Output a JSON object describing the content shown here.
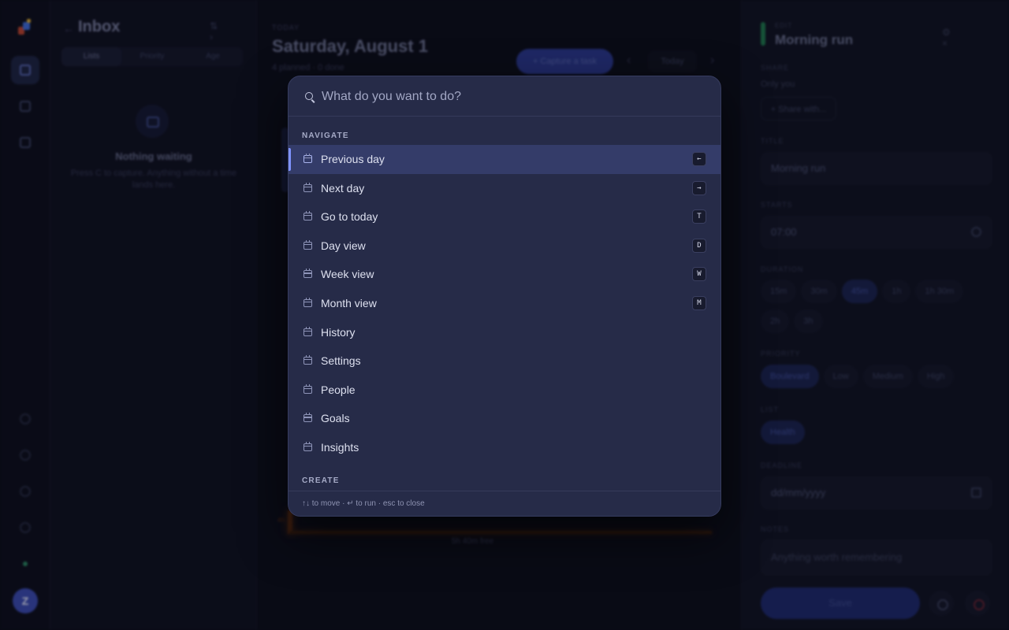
{
  "rail": {
    "avatar_initial": "Z",
    "colors": {
      "accent": "#3c4db5",
      "status_dot": "#2c8a63"
    }
  },
  "inbox": {
    "back_icon": "←",
    "title": "Inbox",
    "actions": "⇅ ›",
    "tabs": [
      {
        "label": "Lists"
      },
      {
        "label": "Priority"
      },
      {
        "label": "Age"
      }
    ],
    "empty_title": "Nothing waiting",
    "empty_subtitle": "Press C to capture. Anything without a time lands here."
  },
  "main": {
    "eyebrow": "TODAY",
    "title": "Saturday, August 1",
    "meta": "4 planned · 0 done",
    "capture_button": "+  Capture a task",
    "prev_icon": "‹",
    "today_button": "Today",
    "next_icon": "›",
    "orange_label": "4h",
    "free_label": "5h 40m free"
  },
  "details": {
    "eyebrow": "EDIT",
    "title": "Morning run",
    "header_icons": "⚙ ×",
    "share_label": "SHARE",
    "share_text": "Only you",
    "share_button": "+  Share with...",
    "title_label": "TITLE",
    "title_value": "Morning run",
    "starts_label": "STARTS",
    "starts_value": "07:00",
    "duration_label": "DURATION",
    "durations": [
      "15m",
      "30m",
      "45m",
      "1h",
      "1h 30m",
      "2h",
      "3h"
    ],
    "priority_label": "PRIORITY",
    "priorities": [
      "Boulevard",
      "Low",
      "Medium",
      "High"
    ],
    "list_label": "LIST",
    "list_value": "Health",
    "deadline_label": "DEADLINE",
    "deadline_placeholder": "dd/mm/yyyy",
    "notes_label": "NOTES",
    "notes_placeholder": "Anything worth remembering",
    "save_button": "Save"
  },
  "palette": {
    "search_placeholder": "What do you want to do?",
    "groups": [
      {
        "label": "NAVIGATE",
        "items": [
          {
            "label": "Previous day",
            "shortcut": "←",
            "icon": "calendar-icon",
            "active": true
          },
          {
            "label": "Next day",
            "shortcut": "→",
            "icon": "calendar-icon"
          },
          {
            "label": "Go to today",
            "shortcut": "T",
            "icon": "calendar-icon"
          },
          {
            "label": "Day view",
            "shortcut": "D",
            "icon": "calendar-icon"
          },
          {
            "label": "Week view",
            "shortcut": "W",
            "icon": "calendar-icon"
          },
          {
            "label": "Month view",
            "shortcut": "M",
            "icon": "calendar-icon"
          },
          {
            "label": "History",
            "shortcut": "",
            "icon": "calendar-icon"
          },
          {
            "label": "Settings",
            "shortcut": "",
            "icon": "calendar-icon"
          },
          {
            "label": "People",
            "shortcut": "",
            "icon": "calendar-icon"
          },
          {
            "label": "Goals",
            "shortcut": "",
            "icon": "calendar-icon"
          },
          {
            "label": "Insights",
            "shortcut": "",
            "icon": "calendar-icon"
          }
        ]
      },
      {
        "label": "CREATE",
        "items": []
      }
    ],
    "footer": "↑↓ to move · ↵ to run · esc to close",
    "colors": {
      "active_row": "#343c69",
      "active_indicator": "#7f93ff",
      "surface": "#262b48"
    }
  }
}
